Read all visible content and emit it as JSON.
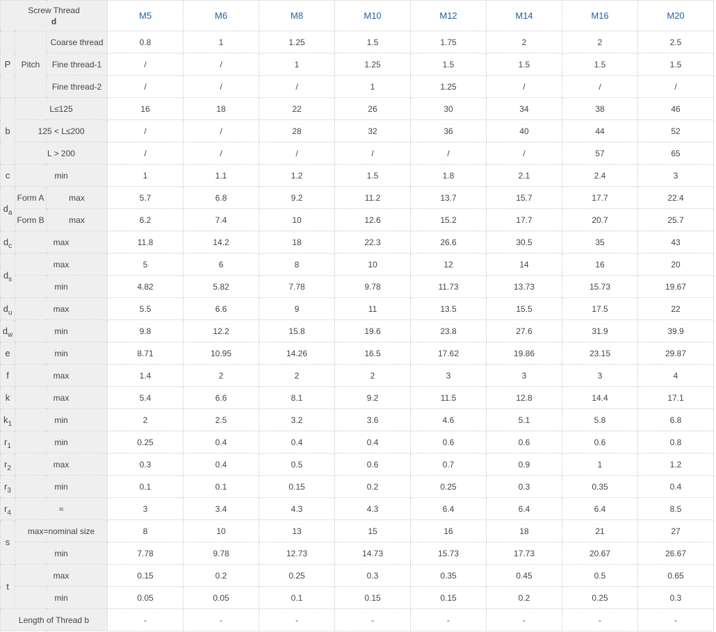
{
  "header": {
    "title": "Screw Thread",
    "symbol": "d",
    "columns": [
      "M5",
      "M6",
      "M8",
      "M10",
      "M12",
      "M14",
      "M16",
      "M20"
    ]
  },
  "rows": {
    "pitch": {
      "symbol": "P",
      "label": "Pitch",
      "coarse": {
        "label": "Coarse thread",
        "values": [
          "0.8",
          "1",
          "1.25",
          "1.5",
          "1.75",
          "2",
          "2",
          "2.5"
        ]
      },
      "fine1": {
        "label": "Fine thread-1",
        "values": [
          "/",
          "/",
          "1",
          "1.25",
          "1.5",
          "1.5",
          "1.5",
          "1.5"
        ]
      },
      "fine2": {
        "label": "Fine thread-2",
        "values": [
          "/",
          "/",
          "/",
          "1",
          "1.25",
          "/",
          "/",
          "/"
        ]
      }
    },
    "b": {
      "symbol": "b",
      "r1": {
        "label": "L≤125",
        "values": [
          "16",
          "18",
          "22",
          "26",
          "30",
          "34",
          "38",
          "46"
        ]
      },
      "r2": {
        "label": "125 < L≤200",
        "values": [
          "/",
          "/",
          "28",
          "32",
          "36",
          "40",
          "44",
          "52"
        ]
      },
      "r3": {
        "label": "L > 200",
        "values": [
          "/",
          "/",
          "/",
          "/",
          "/",
          "/",
          "57",
          "65"
        ]
      }
    },
    "c": {
      "symbol": "c",
      "label": "min",
      "values": [
        "1",
        "1.1",
        "1.2",
        "1.5",
        "1.8",
        "2.1",
        "2.4",
        "3"
      ]
    },
    "da": {
      "symbol": "d",
      "sub": "a",
      "formA": {
        "label": "Form A",
        "limit": "max",
        "values": [
          "5.7",
          "6.8",
          "9.2",
          "11.2",
          "13.7",
          "15.7",
          "17.7",
          "22.4"
        ]
      },
      "formB": {
        "label": "Form B",
        "limit": "max",
        "values": [
          "6.2",
          "7.4",
          "10",
          "12.6",
          "15.2",
          "17.7",
          "20.7",
          "25.7"
        ]
      }
    },
    "dc": {
      "symbol": "d",
      "sub": "c",
      "label": "max",
      "values": [
        "11.8",
        "14.2",
        "18",
        "22.3",
        "26.6",
        "30.5",
        "35",
        "43"
      ]
    },
    "ds": {
      "symbol": "d",
      "sub": "s",
      "max": {
        "label": "max",
        "values": [
          "5",
          "6",
          "8",
          "10",
          "12",
          "14",
          "16",
          "20"
        ]
      },
      "min": {
        "label": "min",
        "values": [
          "4.82",
          "5.82",
          "7.78",
          "9.78",
          "11.73",
          "13.73",
          "15.73",
          "19.67"
        ]
      }
    },
    "du": {
      "symbol": "d",
      "sub": "u",
      "label": "max",
      "values": [
        "5.5",
        "6.6",
        "9",
        "11",
        "13.5",
        "15.5",
        "17.5",
        "22"
      ]
    },
    "dw": {
      "symbol": "d",
      "sub": "w",
      "label": "min",
      "values": [
        "9.8",
        "12.2",
        "15.8",
        "19.6",
        "23.8",
        "27.6",
        "31.9",
        "39.9"
      ]
    },
    "e": {
      "symbol": "e",
      "label": "min",
      "values": [
        "8.71",
        "10.95",
        "14.26",
        "16.5",
        "17.62",
        "19.86",
        "23.15",
        "29.87"
      ]
    },
    "f": {
      "symbol": "f",
      "label": "max",
      "values": [
        "1.4",
        "2",
        "2",
        "2",
        "3",
        "3",
        "3",
        "4"
      ]
    },
    "k": {
      "symbol": "k",
      "label": "max",
      "values": [
        "5.4",
        "6.6",
        "8.1",
        "9.2",
        "11.5",
        "12.8",
        "14.4",
        "17.1"
      ]
    },
    "k1": {
      "symbol": "k",
      "sub": "1",
      "label": "min",
      "values": [
        "2",
        "2.5",
        "3.2",
        "3.6",
        "4.6",
        "5.1",
        "5.8",
        "6.8"
      ]
    },
    "r1": {
      "symbol": "r",
      "sub": "1",
      "label": "min",
      "values": [
        "0.25",
        "0.4",
        "0.4",
        "0.4",
        "0.6",
        "0.6",
        "0.6",
        "0.8"
      ]
    },
    "r2": {
      "symbol": "r",
      "sub": "2",
      "label": "max",
      "values": [
        "0.3",
        "0.4",
        "0.5",
        "0.6",
        "0.7",
        "0.9",
        "1",
        "1.2"
      ]
    },
    "r3": {
      "symbol": "r",
      "sub": "3",
      "label": "min",
      "values": [
        "0.1",
        "0.1",
        "0.15",
        "0.2",
        "0.25",
        "0.3",
        "0.35",
        "0.4"
      ]
    },
    "r4": {
      "symbol": "r",
      "sub": "4",
      "label": "≈",
      "values": [
        "3",
        "3.4",
        "4.3",
        "4.3",
        "6.4",
        "6.4",
        "6.4",
        "8.5"
      ]
    },
    "s": {
      "symbol": "s",
      "max": {
        "label": "max=nominal size",
        "values": [
          "8",
          "10",
          "13",
          "15",
          "16",
          "18",
          "21",
          "27"
        ]
      },
      "min": {
        "label": "min",
        "values": [
          "7.78",
          "9.78",
          "12.73",
          "14.73",
          "15.73",
          "17.73",
          "20.67",
          "26.67"
        ]
      }
    },
    "t": {
      "symbol": "t",
      "max": {
        "label": "max",
        "values": [
          "0.15",
          "0.2",
          "0.25",
          "0.3",
          "0.35",
          "0.45",
          "0.5",
          "0.65"
        ]
      },
      "min": {
        "label": "min",
        "values": [
          "0.05",
          "0.05",
          "0.1",
          "0.15",
          "0.15",
          "0.2",
          "0.25",
          "0.3"
        ]
      }
    },
    "thread_length": {
      "label": "Length of Thread b",
      "values": [
        "-",
        "-",
        "-",
        "-",
        "-",
        "-",
        "-",
        "-"
      ]
    }
  }
}
